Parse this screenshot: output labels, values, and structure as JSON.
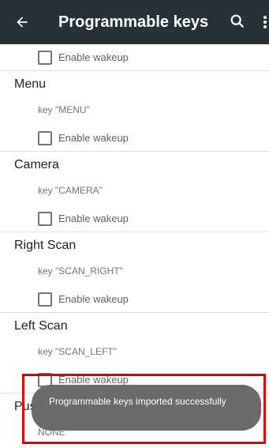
{
  "appbar": {
    "title": "Programmable keys",
    "back_icon": "arrow-left-icon",
    "search_icon": "search-icon",
    "overflow_icon": "more-vert-icon",
    "background": "#263238"
  },
  "top_checkbox": {
    "label": "Enable wakeup",
    "checked": false
  },
  "keys": [
    {
      "title": "Menu",
      "key": "key \"MENU\"",
      "wakeup_label": "Enable wakeup",
      "checked": false
    },
    {
      "title": "Camera",
      "key": "key \"CAMERA\"",
      "wakeup_label": "Enable wakeup",
      "checked": false
    },
    {
      "title": "Right Scan",
      "key": "key \"SCAN_RIGHT\"",
      "wakeup_label": "Enable wakeup",
      "checked": false
    },
    {
      "title": "Left Scan",
      "key": "key \"SCAN_LEFT\"",
      "wakeup_label": "Enable wakeup",
      "checked": false
    },
    {
      "title": "Push",
      "key": "NONE"
    }
  ],
  "toast": {
    "message": "Programmable keys imported successfully",
    "background": "#6b6b6b"
  },
  "highlight_color": "#e00000"
}
